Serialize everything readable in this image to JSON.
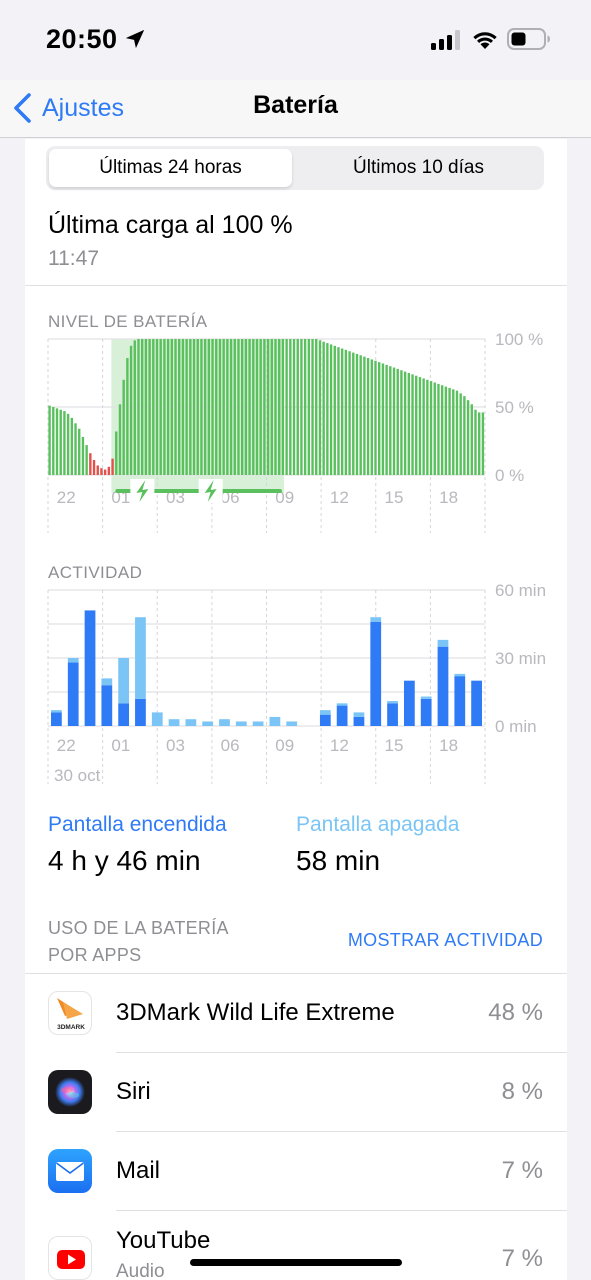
{
  "status_bar": {
    "time": "20:50"
  },
  "nav": {
    "back_label": "Ajustes",
    "title": "Batería"
  },
  "segmented": {
    "option_1": "Últimas 24 horas",
    "option_2": "Últimos 10 días",
    "selected": "Últimas 24 horas"
  },
  "last_charge": {
    "title": "Última carga al 100 %",
    "time": "11:47"
  },
  "battery_chart": {
    "label": "NIVEL DE BATERÍA",
    "y_ticks": [
      "100 %",
      "50 %",
      "0 %"
    ],
    "x_ticks": [
      "22",
      "01",
      "03",
      "06",
      "09",
      "12",
      "15",
      "18"
    ]
  },
  "activity_chart": {
    "label": "ACTIVIDAD",
    "y_ticks": [
      "60 min",
      "30 min",
      "0 min"
    ],
    "x_ticks": [
      "22",
      "01",
      "03",
      "06",
      "09",
      "12",
      "15",
      "18"
    ],
    "date_label": "30 oct"
  },
  "chart_data": [
    {
      "type": "bar",
      "title": "NIVEL DE BATERÍA",
      "ylabel": "",
      "ylim": [
        0,
        100
      ],
      "unit": "%",
      "x_ticks": [
        "22",
        "01",
        "03",
        "06",
        "09",
        "12",
        "15",
        "18"
      ],
      "values": [
        51,
        50,
        49,
        48,
        47,
        45,
        42,
        38,
        34,
        28,
        22,
        16,
        11,
        7,
        5,
        4,
        6,
        12,
        32,
        52,
        70,
        86,
        95,
        99,
        100,
        100,
        100,
        100,
        100,
        100,
        100,
        100,
        100,
        100,
        100,
        100,
        100,
        100,
        100,
        100,
        100,
        100,
        100,
        100,
        100,
        100,
        100,
        100,
        100,
        100,
        100,
        100,
        100,
        100,
        100,
        100,
        100,
        100,
        100,
        100,
        100,
        100,
        100,
        100,
        100,
        100,
        100,
        100,
        100,
        100,
        100,
        100,
        100,
        99,
        98,
        97,
        96,
        95,
        94,
        93,
        92,
        91,
        90,
        89,
        88,
        87,
        86,
        85,
        84,
        83,
        82,
        81,
        80,
        79,
        78,
        77,
        76,
        75,
        74,
        73,
        72,
        71,
        70,
        69,
        68,
        67,
        66,
        65,
        64,
        63,
        62,
        60,
        58,
        55,
        52,
        48,
        46,
        46
      ],
      "low_battery_threshold": 20,
      "charging_ranges": [
        [
          0.145,
          0.54
        ]
      ],
      "colors": {
        "normal": "#5ac05e",
        "low": "#e0524b",
        "charging_bg": "#d9f0d8"
      }
    },
    {
      "type": "bar",
      "title": "ACTIVIDAD",
      "ylabel": "",
      "ylim": [
        0,
        60
      ],
      "unit": "min",
      "x_ticks": [
        "22",
        "01",
        "03",
        "06",
        "09",
        "12",
        "15",
        "18"
      ],
      "series": [
        {
          "name": "Pantalla encendida",
          "color": "#2f7bf5",
          "values": [
            6,
            28,
            51,
            18,
            10,
            12,
            0,
            0,
            0,
            0,
            0,
            0,
            0,
            0,
            0,
            0,
            5,
            9,
            4,
            46,
            10,
            20,
            12,
            35,
            22,
            20
          ]
        },
        {
          "name": "Pantalla apagada",
          "color": "#7ac5f5",
          "values": [
            1,
            2,
            0,
            3,
            20,
            36,
            6,
            3,
            3,
            2,
            3,
            2,
            2,
            4,
            2,
            0,
            2,
            1,
            2,
            2,
            1,
            0,
            1,
            3,
            1,
            0
          ]
        }
      ]
    }
  ],
  "legend": {
    "screen_on_label": "Pantalla encendida",
    "screen_on_value": "4 h y 46 min",
    "screen_off_label": "Pantalla apagada",
    "screen_off_value": "58 min"
  },
  "usage": {
    "label_line1": "USO DE LA BATERÍA",
    "label_line2": "POR APPS",
    "show_activity": "MOSTRAR ACTIVIDAD",
    "apps": [
      {
        "name": "3DMark Wild Life Extreme",
        "sub": "",
        "percent": "48 %",
        "icon": "3dmark-icon",
        "icon_text": "3DMARK"
      },
      {
        "name": "Siri",
        "sub": "",
        "percent": "8 %",
        "icon": "siri-icon"
      },
      {
        "name": "Mail",
        "sub": "",
        "percent": "7 %",
        "icon": "mail-icon"
      },
      {
        "name": "YouTube",
        "sub": "Audio",
        "percent": "7 %",
        "icon": "youtube-icon"
      }
    ]
  }
}
